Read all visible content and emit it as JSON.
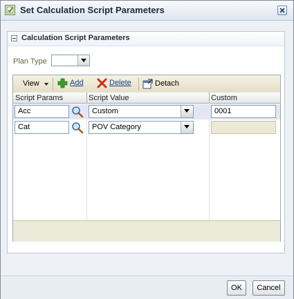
{
  "dialog": {
    "title": "Set Calculation Script Parameters"
  },
  "panel": {
    "title": "Calculation Script Parameters"
  },
  "plan_type": {
    "label": "Plan Type",
    "value": ""
  },
  "toolbar": {
    "view_label": "View",
    "add_label": "Add",
    "delete_label": "Delete",
    "detach_label": "Detach"
  },
  "table": {
    "columns": [
      "Script Params",
      "Script Value",
      "Custom"
    ],
    "rows": [
      {
        "param": "Acc",
        "value": "Custom",
        "custom": "0001"
      },
      {
        "param": "Cat",
        "value": "POV Category",
        "custom": ""
      }
    ]
  },
  "buttons": {
    "ok": "OK",
    "cancel": "Cancel"
  }
}
